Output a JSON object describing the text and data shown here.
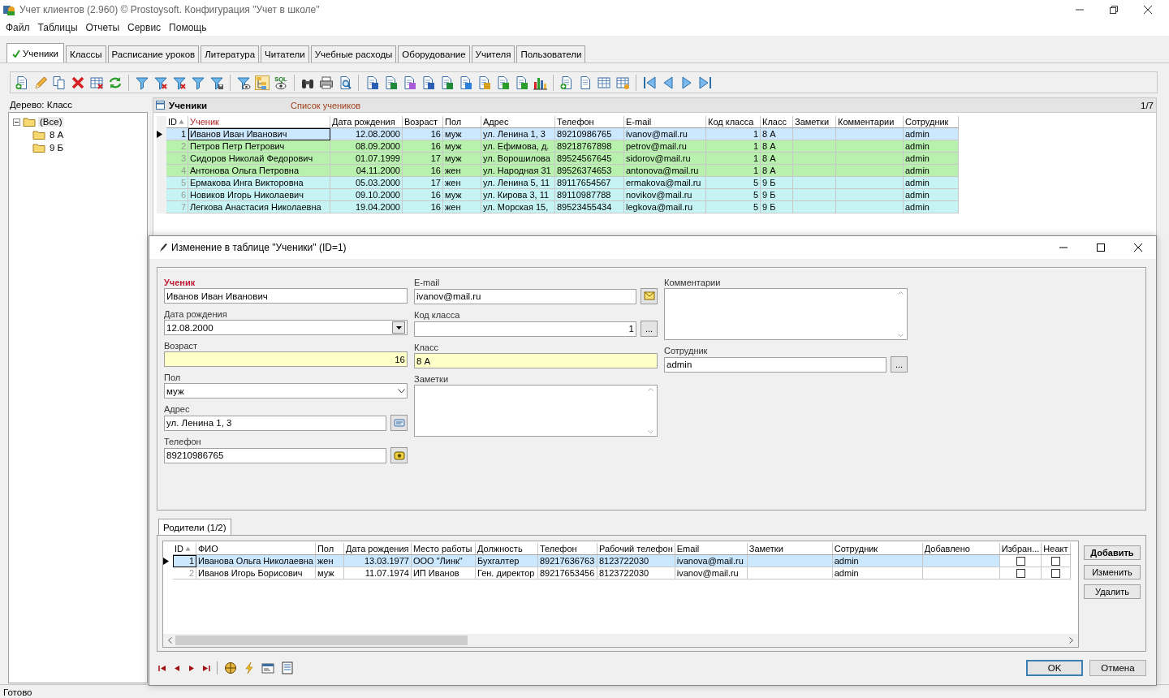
{
  "window": {
    "title": "Учет клиентов (2.960) © Prostoysoft. Конфигурация \"Учет в школе\""
  },
  "menu": [
    "Файл",
    "Таблицы",
    "Отчеты",
    "Сервис",
    "Помощь"
  ],
  "tabs": [
    {
      "label": "Ученики",
      "selected": true
    },
    {
      "label": "Классы",
      "selected": false
    },
    {
      "label": "Расписание уроков",
      "selected": false
    },
    {
      "label": "Литература",
      "selected": false
    },
    {
      "label": "Читатели",
      "selected": false
    },
    {
      "label": "Учебные расходы",
      "selected": false
    },
    {
      "label": "Оборудование",
      "selected": false
    },
    {
      "label": "Учителя",
      "selected": false
    },
    {
      "label": "Пользователи",
      "selected": false
    }
  ],
  "toolbar": {
    "sql_label": "SQL"
  },
  "tree": {
    "title": "Дерево: Класс",
    "items": [
      {
        "label": "(Все)",
        "expanded": true,
        "selected": true,
        "children": [
          {
            "label": "8 А",
            "selected": false
          },
          {
            "label": "9 Б",
            "selected": false
          }
        ]
      }
    ]
  },
  "grid": {
    "title": "Ученики",
    "subtitle": "Список учеников",
    "position": "1/7",
    "columns": [
      {
        "label": "ID",
        "sorted": true,
        "key": false,
        "kind": "number"
      },
      {
        "label": "Ученик",
        "sorted": false,
        "key": true,
        "kind": "text"
      },
      {
        "label": "Дата рождения",
        "sorted": false,
        "key": false,
        "kind": "number"
      },
      {
        "label": "Возраст",
        "sorted": false,
        "key": false,
        "kind": "number"
      },
      {
        "label": "Пол",
        "sorted": false,
        "key": false,
        "kind": "text"
      },
      {
        "label": "Адрес",
        "sorted": false,
        "key": false,
        "kind": "text"
      },
      {
        "label": "Телефон",
        "sorted": false,
        "key": false,
        "kind": "text"
      },
      {
        "label": "E-mail",
        "sorted": false,
        "key": false,
        "kind": "text"
      },
      {
        "label": "Код класса",
        "sorted": false,
        "key": false,
        "kind": "number"
      },
      {
        "label": "Класс",
        "sorted": false,
        "key": false,
        "kind": "text"
      },
      {
        "label": "Заметки",
        "sorted": false,
        "key": false,
        "kind": "text"
      },
      {
        "label": "Комментарии",
        "sorted": false,
        "key": false,
        "kind": "text"
      },
      {
        "label": "Сотрудник",
        "sorted": false,
        "key": false,
        "kind": "text"
      }
    ],
    "rows": [
      {
        "selected": true,
        "color": "#cce8ff",
        "cells": [
          "1",
          "Иванов Иван Иванович",
          "12.08.2000",
          "16",
          "муж",
          "ул. Ленина 1, 3",
          "89210986765",
          "ivanov@mail.ru",
          "1",
          "8 А",
          null,
          null,
          "admin"
        ]
      },
      {
        "selected": false,
        "color": "#b8f0ae",
        "cells": [
          "2",
          "Петров Петр Петрович",
          "08.09.2000",
          "16",
          "муж",
          "ул. Ефимова, д.",
          "89218767898",
          "petrov@mail.ru",
          "1",
          "8 А",
          null,
          null,
          "admin"
        ]
      },
      {
        "selected": false,
        "color": "#b8f0ae",
        "cells": [
          "3",
          "Сидоров Николай Федорович",
          "01.07.1999",
          "17",
          "муж",
          "ул. Ворошилова",
          "89524567645",
          "sidorov@mail.ru",
          "1",
          "8 А",
          null,
          null,
          "admin"
        ]
      },
      {
        "selected": false,
        "color": "#b8f0ae",
        "cells": [
          "4",
          "Антонова Ольга Петровна",
          "04.11.2000",
          "16",
          "жен",
          "ул. Народная 31",
          "89526374653",
          "antonova@mail.ru",
          "1",
          "8 А",
          null,
          null,
          "admin"
        ]
      },
      {
        "selected": false,
        "color": "#c6f4f4",
        "cells": [
          "5",
          "Ермакова Инга Викторовна",
          "05.03.2000",
          "17",
          "жен",
          "ул. Ленина 5, 11",
          "89117654567",
          "ermakova@mail.ru",
          "5",
          "9 Б",
          null,
          null,
          "admin"
        ]
      },
      {
        "selected": false,
        "color": "#c6f4f4",
        "cells": [
          "6",
          "Новиков Игорь Николаевич",
          "09.10.2000",
          "16",
          "муж",
          "ул. Кирова 3, 11",
          "89110987788",
          "novikov@mail.ru",
          "5",
          "9 Б",
          null,
          null,
          "admin"
        ]
      },
      {
        "selected": false,
        "color": "#c6f4f4",
        "cells": [
          "7",
          "Легкова Анастасия Николаевна",
          "19.04.2000",
          "16",
          "жен",
          "ул. Морская 15,",
          "89523455434",
          "legkova@mail.ru",
          "5",
          "9 Б",
          null,
          null,
          "admin"
        ]
      }
    ]
  },
  "dialog": {
    "title": "Изменение в таблице \"Ученики\" (ID=1)",
    "form_columns": [
      [
        {
          "label": "Ученик",
          "value": "Иванов Иван Иванович",
          "kind": "text",
          "required": true
        },
        {
          "label": "Дата рождения",
          "value": "12.08.2000",
          "kind": "date",
          "required": false
        },
        {
          "label": "Возраст",
          "value": "16",
          "kind": "number",
          "required": false,
          "readonly": true
        },
        {
          "label": "Пол",
          "value": "муж",
          "kind": "select",
          "required": false
        },
        {
          "label": "Адрес",
          "value": "ул. Ленина 1, 3",
          "kind": "text",
          "required": false,
          "button": {
            "kind": "address"
          }
        },
        {
          "label": "Телефон",
          "value": "89210986765",
          "kind": "text",
          "required": false,
          "button": {
            "kind": "phone"
          }
        }
      ],
      [
        {
          "label": "E-mail",
          "value": "ivanov@mail.ru",
          "kind": "text",
          "required": false,
          "button": {
            "kind": "email"
          }
        },
        {
          "label": "Код класса",
          "value": "1",
          "kind": "number",
          "required": false,
          "button": {
            "kind": "lookup",
            "label": "..."
          }
        },
        {
          "label": "Класс",
          "value": "8 А",
          "kind": "text",
          "required": false,
          "readonly": true
        },
        {
          "label": "Заметки",
          "kind": "memo",
          "required": false
        }
      ],
      [
        {
          "label": "Комментарии",
          "kind": "memo",
          "required": false
        },
        {
          "label": "Сотрудник",
          "value": "admin",
          "kind": "text",
          "required": false,
          "button": {
            "kind": "lookup",
            "label": "..."
          }
        }
      ]
    ],
    "parents": {
      "tab": "Родители (1/2)",
      "columns": [
        {
          "label": "ID",
          "sorted": true,
          "kind": "number"
        },
        {
          "label": "ФИО",
          "sorted": false,
          "kind": "text"
        },
        {
          "label": "Пол",
          "sorted": false,
          "kind": "text"
        },
        {
          "label": "Дата рождения",
          "sorted": false,
          "kind": "number"
        },
        {
          "label": "Место работы",
          "sorted": false,
          "kind": "text"
        },
        {
          "label": "Должность",
          "sorted": false,
          "kind": "text"
        },
        {
          "label": "Телефон",
          "sorted": false,
          "kind": "text"
        },
        {
          "label": "Рабочий телефон",
          "sorted": false,
          "kind": "text"
        },
        {
          "label": "Email",
          "sorted": false,
          "kind": "text"
        },
        {
          "label": "Заметки",
          "sorted": false,
          "kind": "text"
        },
        {
          "label": "Сотрудник",
          "sorted": false,
          "kind": "text"
        },
        {
          "label": "Добавлено",
          "sorted": false,
          "kind": "text"
        },
        {
          "label": "Избран...",
          "sorted": false,
          "kind": "check"
        },
        {
          "label": "Неакт",
          "sorted": false,
          "kind": "check"
        }
      ],
      "rows": [
        {
          "selected": true,
          "cells": [
            "1",
            "Иванова Ольга Николаевна",
            "жен",
            "13.03.1977",
            "ООО \"Линк\"",
            "Бухгалтер",
            "89217636763",
            "8123722030",
            "ivanova@mail.ru",
            null,
            "admin",
            null,
            false,
            false
          ]
        },
        {
          "selected": false,
          "cells": [
            "2",
            "Иванов Игорь Борисович",
            "муж",
            "11.07.1974",
            "ИП Иванов",
            "Ген. директор",
            "89217653456",
            "8123722030",
            "ivanov@mail.ru",
            null,
            "admin",
            null,
            false,
            false
          ]
        }
      ],
      "buttons": [
        {
          "label": "Добавить",
          "primary": true
        },
        {
          "label": "Изменить",
          "primary": false
        },
        {
          "label": "Удалить",
          "primary": false
        }
      ]
    },
    "buttons": [
      {
        "label": "OK",
        "default": true
      },
      {
        "label": "Отмена",
        "default": false
      }
    ]
  },
  "status_bar": {
    "text": "Готово"
  }
}
